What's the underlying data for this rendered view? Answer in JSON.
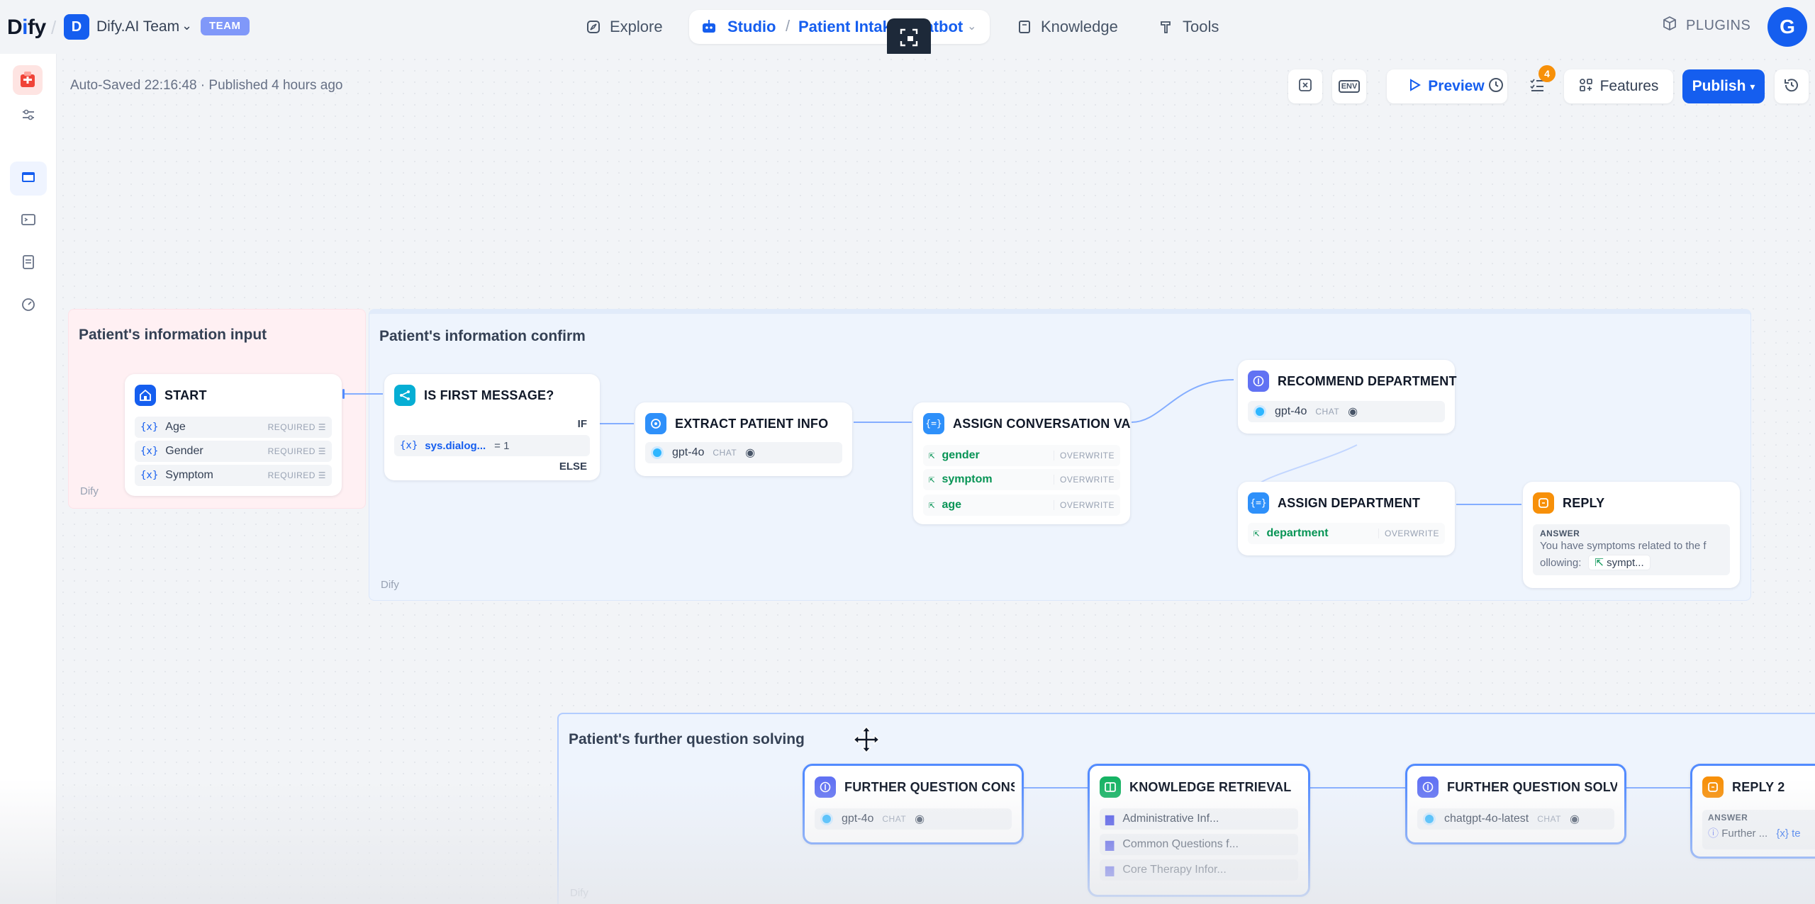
{
  "header": {
    "logo": "Dify",
    "workspace_initial": "D",
    "workspace_name": "Dify.AI Team",
    "team_badge": "TEAM",
    "nav": {
      "explore": "Explore",
      "studio": "Studio",
      "app_name": "Patient Intake Chatbot",
      "knowledge": "Knowledge",
      "tools": "Tools"
    },
    "plugins": "PLUGINS",
    "user_initial": "G"
  },
  "toolbar": {
    "saved_status": "Auto-Saved 22:16:48 · Published 4 hours ago",
    "env_label": "ENV",
    "preview": "Preview",
    "checklist_count": "4",
    "features": "Features",
    "publish": "Publish"
  },
  "groups": {
    "input": {
      "title": "Patient's information input",
      "footer": "Dify"
    },
    "confirm": {
      "title": "Patient's information confirm",
      "footer": "Dify"
    },
    "further": {
      "title": "Patient's further question solving",
      "footer": "Dify"
    }
  },
  "nodes": {
    "start": {
      "title": "START",
      "vars": [
        {
          "name": "Age",
          "tag": "REQUIRED"
        },
        {
          "name": "Gender",
          "tag": "REQUIRED"
        },
        {
          "name": "Symptom",
          "tag": "REQUIRED"
        }
      ]
    },
    "is_first": {
      "title": "IS FIRST MESSAGE?",
      "if": "IF",
      "cond_var": "sys.dialog...",
      "cond_op": "= 1",
      "else": "ELSE"
    },
    "extract": {
      "title": "EXTRACT PATIENT INFO",
      "model": "gpt-4o",
      "mode": "CHAT"
    },
    "assign_conv": {
      "title": "ASSIGN CONVERSATION VA",
      "vars": [
        {
          "name": "gender",
          "tag": "OVERWRITE"
        },
        {
          "name": "symptom",
          "tag": "OVERWRITE"
        },
        {
          "name": "age",
          "tag": "OVERWRITE"
        }
      ]
    },
    "recommend": {
      "title": "RECOMMEND DEPARTMENT",
      "model": "gpt-4o",
      "mode": "CHAT"
    },
    "assign_dept": {
      "title": "ASSIGN DEPARTMENT",
      "var": "department",
      "tag": "OVERWRITE"
    },
    "reply": {
      "title": "REPLY",
      "answer_label": "ANSWER",
      "answer_line1": "You have symptoms related to the f",
      "answer_line2": "ollowing:",
      "answer_var": "sympt..."
    },
    "further_consult": {
      "title": "FURTHER QUESTION CONSU",
      "model": "gpt-4o",
      "mode": "CHAT"
    },
    "knowledge": {
      "title": "KNOWLEDGE RETRIEVAL",
      "datasets": [
        "Administrative Inf...",
        "Common Questions f...",
        "Core Therapy Infor..."
      ]
    },
    "further_solving": {
      "title": "FURTHER QUESTION SOLVIN",
      "model": "chatgpt-4o-latest",
      "mode": "CHAT"
    },
    "reply2": {
      "title": "REPLY 2",
      "answer_label": "ANSWER",
      "answer_var1": "Further ...",
      "answer_var2": "te"
    }
  }
}
